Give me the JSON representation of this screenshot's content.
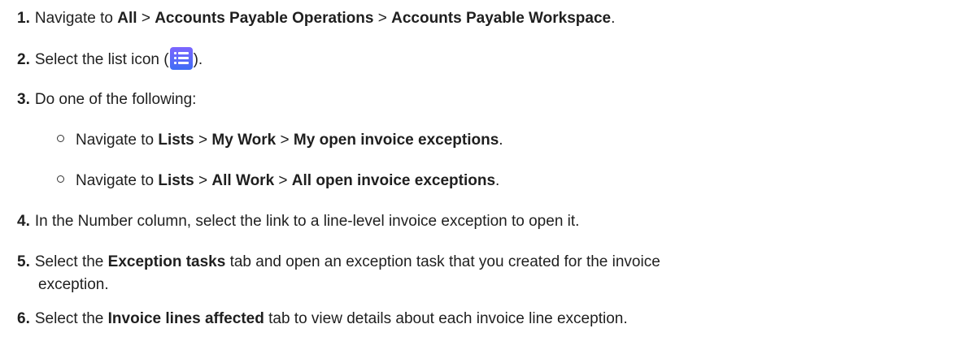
{
  "steps": [
    {
      "num": "1.",
      "pre": "Navigate to ",
      "b1": "All",
      "s1": " > ",
      "b2": "Accounts Payable Operations",
      "s2": " > ",
      "b3": "Accounts Payable Workspace",
      "end": "."
    },
    {
      "num": "2.",
      "pre": "Select the list icon (",
      "end": ")."
    },
    {
      "num": "3.",
      "text": "Do one of the following:"
    },
    {
      "num": "4.",
      "text": "In the Number column, select the link to a line-level invoice exception to open it."
    },
    {
      "num": "5.",
      "pre": "Select the ",
      "b1": "Exception tasks",
      "post": " tab and open an exception task that you created for the invoice",
      "cont": "exception."
    },
    {
      "num": "6.",
      "pre": "Select the ",
      "b1": "Invoice lines affected",
      "post": " tab to view details about each invoice line exception."
    }
  ],
  "substeps": [
    {
      "pre": "Navigate to ",
      "b1": "Lists",
      "s1": " > ",
      "b2": "My Work",
      "s2": " > ",
      "b3": "My open invoice exceptions",
      "end": "."
    },
    {
      "pre": "Navigate to ",
      "b1": "Lists",
      "s1": " > ",
      "b2": "All Work",
      "s2": " > ",
      "b3": "All open invoice exceptions",
      "end": "."
    }
  ],
  "icons": {
    "list": "list-icon"
  }
}
